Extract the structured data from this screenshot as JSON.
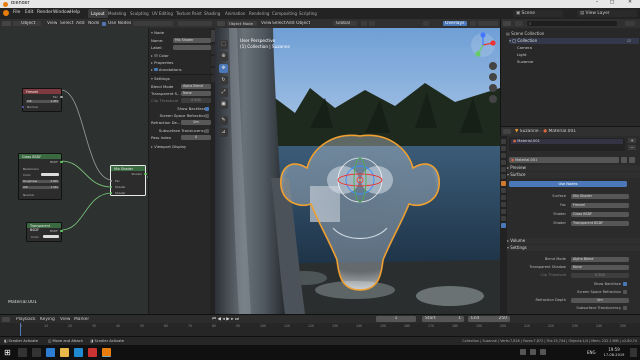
{
  "window": {
    "title": "Blender"
  },
  "menu": {
    "items": [
      "File",
      "Edit",
      "Render",
      "Window",
      "Help"
    ],
    "workspaces": [
      "Layout",
      "Modeling",
      "Sculpting",
      "UV Editing",
      "Texture Paint",
      "Shading",
      "Animation",
      "Rendering",
      "Compositing",
      "Scripting"
    ],
    "scene": "Scene",
    "view_layer": "View Layer"
  },
  "node_editor": {
    "header": {
      "editor": "Object",
      "view": "View",
      "select": "Select",
      "add": "Add",
      "node": "Node",
      "use_nodes": "Use Nodes"
    },
    "material_label": "Material.001",
    "nodes": {
      "fresnel": {
        "title": "Fresnel",
        "out": "Fac",
        "ior_label": "IOR",
        "ior_value": "1.450",
        "normal": "Normal"
      },
      "glass": {
        "title": "Glass BSDF",
        "out": "BSDF",
        "dist": "Beckmann",
        "color": "Color",
        "roughness": "Roughness",
        "roughness_value": "0.000",
        "ior": "IOR",
        "ior_value": "1.450",
        "normal": "Normal"
      },
      "mix": {
        "title": "Mix Shader",
        "out": "Shader",
        "fac": "Fac",
        "in1": "Shader",
        "in2": "Shader"
      },
      "transparent": {
        "title": "Transparent BSDF",
        "out": "BSDF",
        "color": "Color"
      }
    }
  },
  "n_panel": {
    "tabs": [
      "Node",
      "Tool",
      "View",
      "Options"
    ],
    "node_section": "Node",
    "name_label": "Name:",
    "name_value": "Mix Shader",
    "label_label": "Label:",
    "color": "Color",
    "properties": "Properties",
    "annotations": "Annotations",
    "settings": "Settings",
    "blend_mode_label": "Blend Mode",
    "blend_mode_value": "Alpha Blend",
    "transp_shadow_label": "Transparent S...",
    "transp_shadow_value": "None",
    "clip_label": "Clip Threshold",
    "clip_value": "0.500",
    "show_backface": "Show Backface",
    "ssr": "Screen Space Refraction",
    "refr_depth_label": "Refraction De...",
    "refr_depth_value": "0m",
    "subsurface": "Subsurface Translucency",
    "pass_index_label": "Pass Index",
    "pass_index_value": "0",
    "viewport_display": "Viewport Display"
  },
  "viewport": {
    "mode": "Object Mode",
    "view": "View",
    "select": "Select",
    "add": "Add",
    "object": "Object",
    "orientation": "Global",
    "view_name": "User Perspective",
    "collection": "(1) Collection | Suzanne",
    "overlays": "Overlays"
  },
  "outliner": {
    "root": "Scene Collection",
    "collection": "Collection",
    "items": [
      "Camera",
      "Light",
      "Suzanne"
    ]
  },
  "properties": {
    "object": "Suzanne",
    "material": "Material.001",
    "slot_value": "Material.001",
    "preview": "Preview",
    "surface": "Surface",
    "use_nodes": "Use Nodes",
    "surface_label": "Surface",
    "surface_value": "Mix Shader",
    "fac_label": "Fac",
    "fac_value": "Fresnel",
    "shader1_label": "Shader",
    "shader1_value": "Glass BSDF",
    "shader2_label": "Shader",
    "shader2_value": "Transparent BSDF",
    "volume": "Volume",
    "settings": "Settings",
    "blend_label": "Blend Mode",
    "blend_value": "Alpha Blend",
    "shadow_label": "Transparent Shadow",
    "shadow_value": "None",
    "clip_label": "Clip Threshold",
    "clip_value": "0.500",
    "backface": "Show Backface",
    "ssr": "Screen Space Refraction",
    "refr_label": "Refraction Depth",
    "refr_value": "0m",
    "subsurface": "Subsurface Translucency",
    "pass_label": "Pass Index",
    "pass_value": "0",
    "viewport_display": "Viewport Display",
    "custom_props": "Custom Properties"
  },
  "timeline": {
    "playback": "Playback",
    "keying": "Keying",
    "view": "View",
    "marker": "Marker",
    "frame": "1",
    "start_label": "Start",
    "start_value": "1",
    "end_label": "End",
    "end_value": "250",
    "ticks": [
      "0",
      "10",
      "20",
      "30",
      "40",
      "50",
      "60",
      "70",
      "80",
      "90",
      "100",
      "110",
      "120",
      "130",
      "140",
      "150",
      "160",
      "170",
      "180",
      "190",
      "200",
      "210",
      "220",
      "230",
      "240",
      "250"
    ]
  },
  "status": {
    "left1": "Scroller Activate",
    "left2": "Move and Attach",
    "left3": "Scroller Activate",
    "right": "Collection | Suzanne | Verts:7,818 | Faces:7,872 | Tris:15,744 | Objects:1/4 | Mem: 232.2 MiB | v2.80.74"
  },
  "taskbar": {
    "lang": "ENG",
    "time": "19:59",
    "date": "17-08-2019"
  }
}
